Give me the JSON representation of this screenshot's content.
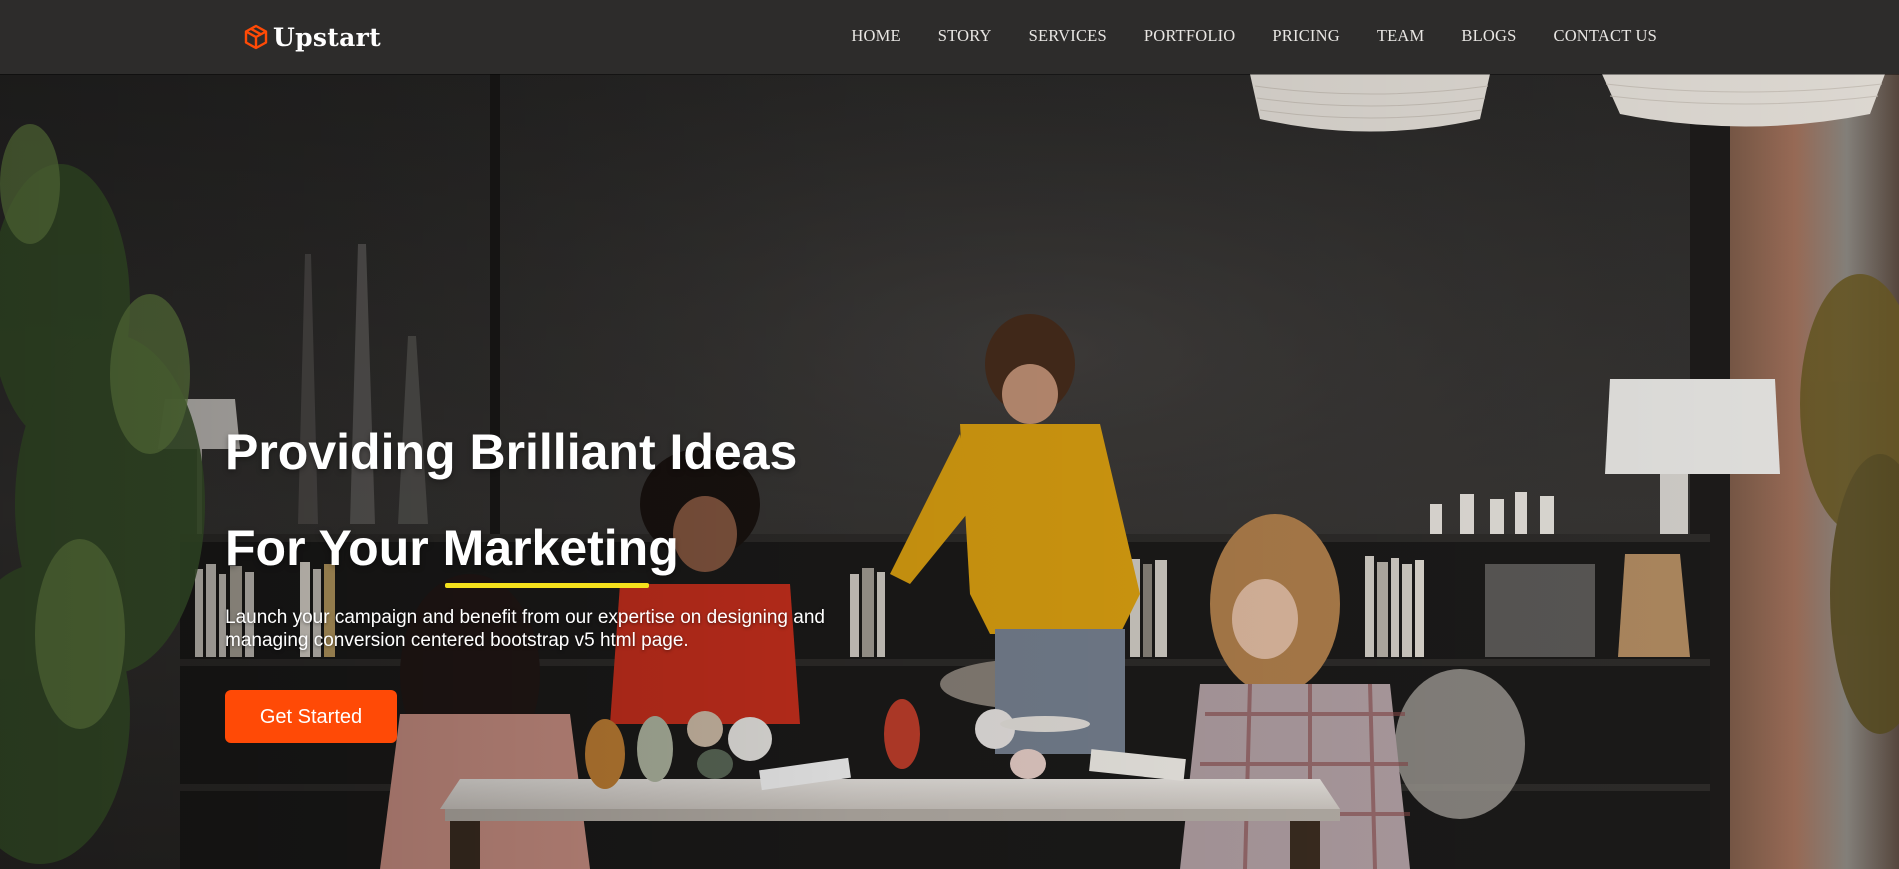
{
  "brand": {
    "name": "Upstart",
    "icon": "cube-logo-icon",
    "accent": "#ff4a06"
  },
  "nav": {
    "items": [
      {
        "label": "HOME"
      },
      {
        "label": "STORY"
      },
      {
        "label": "SERVICES"
      },
      {
        "label": "PORTFOLIO"
      },
      {
        "label": "PRICING"
      },
      {
        "label": "TEAM"
      },
      {
        "label": "BLOGS"
      },
      {
        "label": "CONTACT US"
      }
    ]
  },
  "hero": {
    "title_line1": "Providing Brilliant Ideas",
    "title_line2_prefix": "For Your ",
    "title_line2_highlight": "Marketing",
    "subtitle": "Launch your campaign and benefit from our expertise on designing and managing conversion centered bootstrap v5 html page.",
    "cta_label": "Get Started",
    "image": "office-team-photo",
    "colors": {
      "cta": "#ff4a06",
      "highlight_underline": "#f4e01c",
      "navbar": "#2d2c2b"
    }
  }
}
